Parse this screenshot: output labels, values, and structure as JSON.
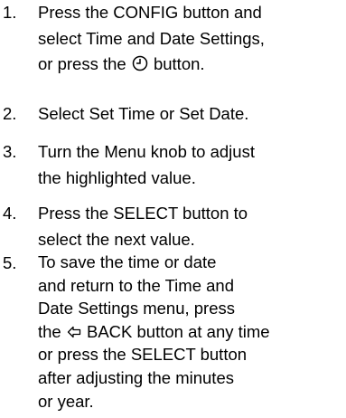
{
  "steps": [
    {
      "number": "1.",
      "lines": [
        "Press the CONFIG button and",
        "select Time and Date Settings,",
        "or press the",
        "button."
      ],
      "icon": "clock-icon"
    },
    {
      "number": "2.",
      "lines": [
        "Select Set Time or Set Date."
      ]
    },
    {
      "number": "3.",
      "lines": [
        "Turn the Menu knob to adjust",
        "the highlighted value."
      ]
    },
    {
      "number": "4.",
      "lines": [
        "Press the SELECT button to",
        "select the next value."
      ]
    },
    {
      "number": "5.",
      "lines": [
        "To save the time or date",
        "and return to the Time and",
        "Date Settings menu, press",
        "the",
        "BACK button at any time",
        "or press the SELECT button",
        "after adjusting the minutes",
        "or year."
      ],
      "icon": "back-arrow-icon"
    }
  ]
}
